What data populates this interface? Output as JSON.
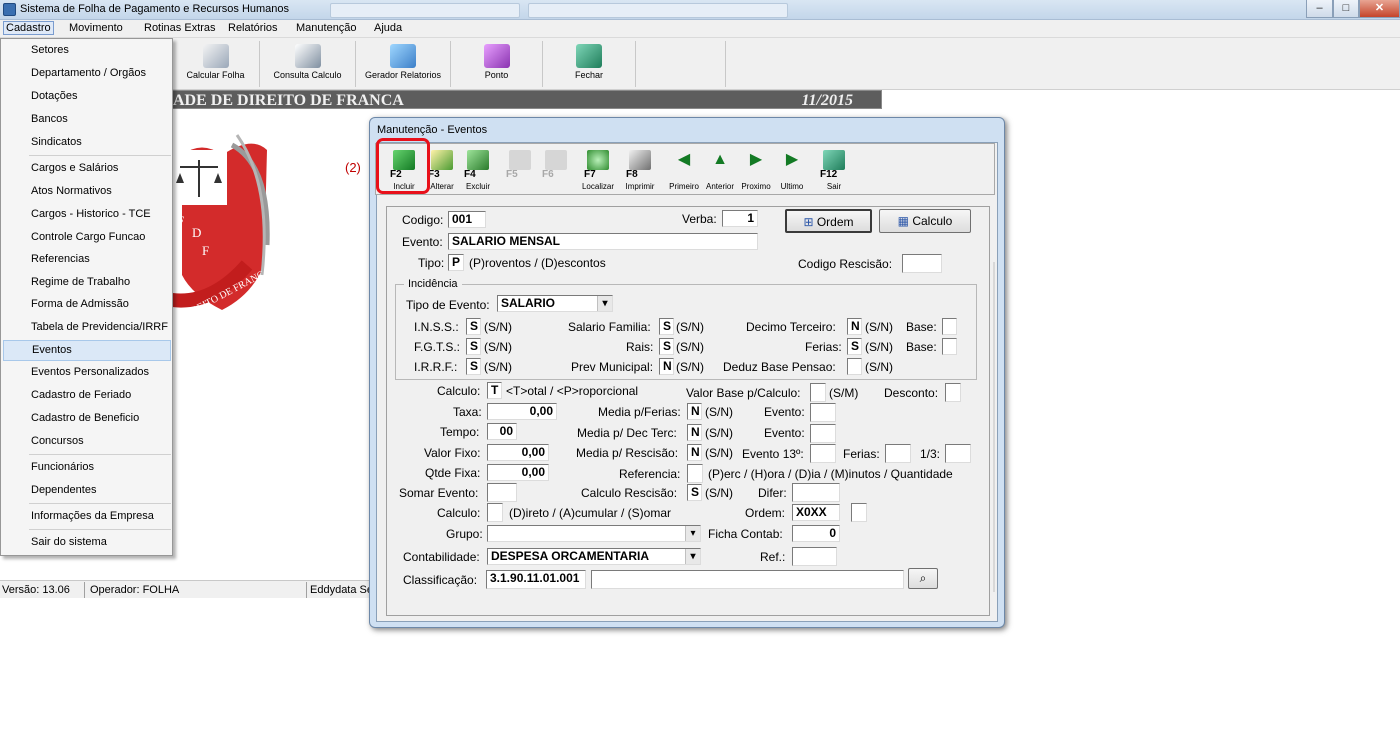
{
  "app": {
    "title": "Sistema de Folha de Pagamento e Recursos Humanos"
  },
  "ghost_tabs": [
    "",
    ""
  ],
  "window_controls": {
    "minimize": "–",
    "maximize": "□",
    "close": "✕"
  },
  "menu": [
    "Cadastro",
    "Movimento",
    "Rotinas Extras",
    "Relatórios",
    "Manutenção",
    "Ajuda"
  ],
  "toolbar": [
    {
      "label": "Calcular Folha",
      "icon": "calculator-icon"
    },
    {
      "label": "Consulta Calculo",
      "icon": "documents-icon"
    },
    {
      "label": "Gerador Relatorios",
      "icon": "report-icon"
    },
    {
      "label": "Ponto",
      "icon": "book-icon"
    },
    {
      "label": "Fechar",
      "icon": "exit-door-icon"
    }
  ],
  "banner": {
    "text": "ADE DE DIREITO DE FRANCA",
    "date": "11/2015"
  },
  "emblem": {
    "letters": [
      "F",
      "D",
      "F"
    ],
    "ribbon": "DIREITO DE FRANCA"
  },
  "annotation": "(2)",
  "dropdown": [
    {
      "label": "Setores"
    },
    {
      "label": "Departamento / Orgãos"
    },
    {
      "label": "Dotações"
    },
    {
      "label": "Bancos"
    },
    {
      "label": "Sindicatos",
      "sep": true
    },
    {
      "label": "Cargos e Salários"
    },
    {
      "label": "Atos Normativos"
    },
    {
      "label": "Cargos - Historico - TCE"
    },
    {
      "label": "Controle Cargo Funcao"
    },
    {
      "label": "Referencias"
    },
    {
      "label": "Regime de Trabalho"
    },
    {
      "label": "Forma de Admissão"
    },
    {
      "label": "Tabela de Previdencia/IRRF"
    },
    {
      "label": "Eventos",
      "selected": true
    },
    {
      "label": "Eventos Personalizados"
    },
    {
      "label": "Cadastro de Feriado"
    },
    {
      "label": "Cadastro de Beneficio"
    },
    {
      "label": "Concursos",
      "sep": true
    },
    {
      "label": "Funcionários"
    },
    {
      "label": "Dependentes",
      "sep": true
    },
    {
      "label": "Informações da Empresa",
      "sep": true
    },
    {
      "label": "Sair do sistema"
    }
  ],
  "status": {
    "version": "Versão: 13.06",
    "operator": "Operador: FOLHA",
    "company": "Eddydata Ser"
  },
  "dialog": {
    "title": "Manutenção - Eventos",
    "tools": [
      {
        "key": "F2",
        "label": "Incluir",
        "icon": "add-record-icon"
      },
      {
        "key": "F3",
        "label": "Alterar",
        "icon": "edit-pencil-icon"
      },
      {
        "key": "F4",
        "label": "Excluir",
        "icon": "delete-bin-icon"
      },
      {
        "key": "F5",
        "label": "",
        "icon": "save-disk-icon",
        "disabled": true
      },
      {
        "key": "F6",
        "label": "",
        "icon": "cancel-icon",
        "disabled": true
      },
      {
        "key": "F7",
        "label": "Localizar",
        "icon": "magnifier-icon"
      },
      {
        "key": "F8",
        "label": "Imprimir",
        "icon": "printer-icon"
      },
      {
        "key": "",
        "label": "Primeiro",
        "icon": "arrow-first-icon"
      },
      {
        "key": "",
        "label": "Anterior",
        "icon": "arrow-prev-icon"
      },
      {
        "key": "",
        "label": "Proximo",
        "icon": "arrow-next-icon"
      },
      {
        "key": "",
        "label": "Ultimo",
        "icon": "arrow-last-icon"
      },
      {
        "key": "F12",
        "label": "Sair",
        "icon": "exit-door-icon"
      }
    ],
    "buttons": {
      "ordem": "Ordem",
      "calculo": "Calculo"
    },
    "labels": {
      "codigo": "Codigo:",
      "verba": "Verba:",
      "evento": "Evento:",
      "tipo": "Tipo:",
      "tipo_hint": "(P)roventos / (D)escontos",
      "codigo_rescisao": "Codigo Rescisão:",
      "incidencia": "Incidência",
      "tipo_evento": "Tipo de Evento:",
      "inss": "I.N.S.S.:",
      "fgts": "F.G.T.S.:",
      "irrf": "I.R.R.F.:",
      "sal_familia": "Salario Familia:",
      "rais": "Rais:",
      "prev_municipal": "Prev Municipal:",
      "decimo": "Decimo Terceiro:",
      "ferias": "Ferias:",
      "deduz": "Deduz Base Pensao:",
      "base": "Base:",
      "sn": "(S/N)",
      "sm": "(S/M)",
      "calculo": "Calculo:",
      "calculo_hint": "<T>otal / <P>roporcional",
      "valor_base": "Valor Base p/Calculo:",
      "desconto": "Desconto:",
      "taxa": "Taxa:",
      "media_ferias": "Media p/Ferias:",
      "evento_c": "Evento:",
      "tempo": "Tempo:",
      "media_dec": "Media p/ Dec Terc:",
      "valor_fixo": "Valor Fixo:",
      "media_resc": "Media p/ Rescisão:",
      "evento13": "Evento 13º:",
      "ferias2": "Ferias:",
      "um_terco": "1/3:",
      "qtde_fixa": "Qtde Fixa:",
      "referencia": "Referencia:",
      "referencia_hint": "(P)erc / (H)ora / (D)ia / (M)inutos / Quantidade",
      "somar_evento": "Somar Evento:",
      "calculo_resc": "Calculo Rescisão:",
      "difer": "Difer:",
      "calculo2": "Calculo:",
      "calculo2_hint": "(D)ireto / (A)cumular / (S)omar",
      "ordem": "Ordem:",
      "grupo": "Grupo:",
      "ficha_contab": "Ficha Contab:",
      "contabilidade": "Contabilidade:",
      "ref": "Ref.:",
      "classificacao": "Classificação:"
    },
    "values": {
      "codigo": "001",
      "verba": "1",
      "evento": "SALARIO MENSAL",
      "tipo": "P",
      "codigo_rescisao": "",
      "tipo_evento": "SALARIO",
      "inss": "S",
      "fgts": "S",
      "irrf": "S",
      "sal_familia": "S",
      "rais": "S",
      "prev_municipal": "N",
      "decimo": "N",
      "ferias": "S",
      "base1": "",
      "base2": "",
      "deduz": "",
      "calculo": "T",
      "valor_base": "",
      "desconto": "",
      "taxa": "0,00",
      "media_ferias": "N",
      "evento_f": "",
      "tempo": "00",
      "media_dec": "N",
      "evento_d": "",
      "valor_fixo": "0,00",
      "media_resc": "N",
      "evento13": "",
      "ferias2": "",
      "um_terco": "",
      "qtde_fixa": "0,00",
      "referencia": "",
      "somar_evento": "",
      "calculo_resc": "S",
      "difer": "",
      "calculo2": "",
      "ordem": "X0XX",
      "ordem2": "",
      "grupo": "",
      "ficha_contab": "0",
      "contabilidade": "DESPESA ORCAMENTARIA",
      "ref": "",
      "classificacao": "3.1.90.11.01.001",
      "classificacao_desc": ""
    }
  }
}
